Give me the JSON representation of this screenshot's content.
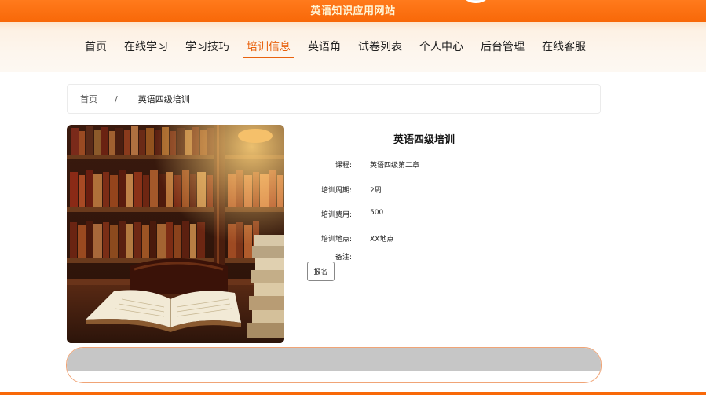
{
  "header": {
    "site_title": "英语知识应用网站"
  },
  "nav": {
    "items": [
      "首页",
      "在线学习",
      "学习技巧",
      "培训信息",
      "英语角",
      "试卷列表",
      "个人中心",
      "后台管理",
      "在线客服"
    ],
    "active_index": 3
  },
  "breadcrumb": {
    "home": "首页",
    "separator": "/",
    "current": "英语四级培训"
  },
  "image": {
    "description_icon": "library-books-photo"
  },
  "detail": {
    "title": "英语四级培训",
    "fields": [
      {
        "label": "课程:",
        "value": "英语四级第二章"
      },
      {
        "label": "培训周期:",
        "value": "2周"
      },
      {
        "label": "培训费用:",
        "value": "500"
      },
      {
        "label": "培训地点:",
        "value": "XX地点"
      },
      {
        "label": "备注:",
        "value": ""
      }
    ],
    "signup_label": "报名"
  },
  "colors": {
    "brand": "#f86808",
    "active_nav": "#e8620e",
    "nav_bg": "#fdf6ee"
  }
}
